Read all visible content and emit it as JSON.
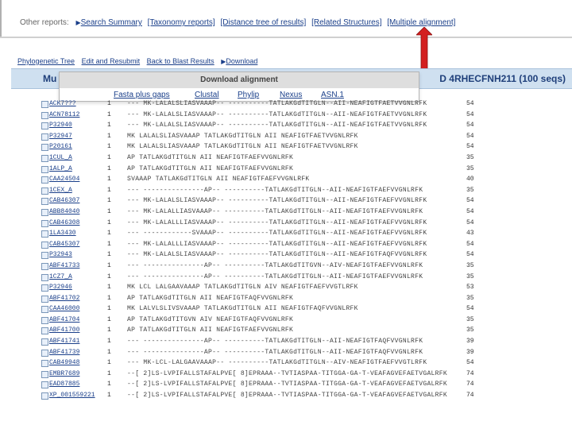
{
  "other_reports": {
    "label": "Other reports:",
    "links": [
      "Search Summary",
      "[Taxonomy reports]",
      "[Distance tree of results]",
      "[Related Structures]",
      "[Multiple alignment]"
    ]
  },
  "nav_links": [
    "Phylogenetic Tree",
    "Edit and Resubmit",
    "Back to Blast Results",
    "Download"
  ],
  "title": {
    "left": "Mu",
    "right": "D 4RHECFNH211 (100 seqs)"
  },
  "download_popup": {
    "title": "Download alignment",
    "options": [
      "Fasta plus gaps",
      "Clustal",
      "Phylip",
      "Nexus",
      "ASN.1"
    ]
  },
  "alignment": [
    {
      "acc": "ACK7???",
      "start": "1",
      "seq": "  ---  MK-LALALSLIASVAAAP--  ----------TATLAKGdTITGLN--AII-NEAFIGTFAETVVGNLRFK",
      "end": "54"
    },
    {
      "acc": "ACN78112",
      "start": "1",
      "seq": "  ---  MK-LALALSLIASVAAAP--  ----------TATLAKGdTITGLN--AII-NEAFIGTFAETVVGNLRFK",
      "end": "54"
    },
    {
      "acc": "P32940",
      "start": "1",
      "seq": "  ---  MK-LALALSLIASVAAAP--  ----------TATLAKGdTITGLN--AII-NEAFIGTFAETVVGNLRFK",
      "end": "54"
    },
    {
      "acc": "P32947",
      "start": "1",
      "seq": "       MK LALALSLIASVAAAP    TATLAKGdTITGLN  AII NEAFIGTFAETVVGNLRFK",
      "end": "54"
    },
    {
      "acc": "P20161",
      "start": "1",
      "seq": "       MK LALALSLIASVAAAP    TATLAKGdTITGLN  AII NEAFIGTFAETVVGNLRFK",
      "end": "54"
    },
    {
      "acc": "1CUL_A",
      "start": "1",
      "seq": "                    AP    TATLAKGdTITGLN  AII NEAFIGTFAEFVVGNLRFK",
      "end": "35"
    },
    {
      "acc": "1ALP_A",
      "start": "1",
      "seq": "                    AP    TATLAKGdTITGLN  AII NEAFIGTFAEFVVGNLRFK",
      "end": "35"
    },
    {
      "acc": "CAA24504",
      "start": "1",
      "seq": "                 SVAAAP    TATLAKGdTITGLN  AII NEAFIGTFAEFVVGNLRFK",
      "end": "40"
    },
    {
      "acc": "1CEX_A",
      "start": "1",
      "seq": "  ---  ---------------AP--  ----------TATLAKGdTITGLN--AII-NEAFIGTFAEFVVGNLRFK",
      "end": "35"
    },
    {
      "acc": "CAB46307",
      "start": "1",
      "seq": "  ---  MK-LALALSLIASVAAAP--  ----------TATLAKGdTITGLN--AII-NEAFIGTFAEFVVGNLRFK",
      "end": "54"
    },
    {
      "acc": "ABB84040",
      "start": "1",
      "seq": "  ---  MK-LALALLIASVAAAP--  ----------TATLAKGdTITGLN--AII-NEAFIGTFAEFVVGNLRFK",
      "end": "54"
    },
    {
      "acc": "CAB46308",
      "start": "1",
      "seq": "  ---  MK-LALALLLIASVAAAP--  ----------TATLAKGdTITGLN--AII-NEAFIGTFAEFVVGNLRFK",
      "end": "54"
    },
    {
      "acc": "1LA3430",
      "start": "1",
      "seq": "  ---  ------------SVAAAP--  ----------TATLAKGdTITGLN--AII-NEAFIGTFAEFVVGNLRFK",
      "end": "43"
    },
    {
      "acc": "CAB45307",
      "start": "1",
      "seq": "  ---  MK-LALALLLIASVAAAP--  ----------TATLAKGdTITGLN--AII-NEAFIGTFAEFVVGNLRFK",
      "end": "54"
    },
    {
      "acc": "P32943",
      "start": "1",
      "seq": "  ---  MK-LALALSLIASVAAAP--  ----------TATLAKGdTITGLN--AII-NEAFIGTFAQFVVGNLRFK",
      "end": "54"
    },
    {
      "acc": "ABF41733",
      "start": "1",
      "seq": "  ---  ---------------AP--  ----------TATLAKGdTITGVN--AIV-NEAFIGTFAEFVVGNLRFK",
      "end": "35"
    },
    {
      "acc": "1CZ7_A",
      "start": "1",
      "seq": "  ---  ---------------AP--  ----------TATLAKGdTITGLN--AII-NEAFIGTFAEFVVGNLRFK",
      "end": "35"
    },
    {
      "acc": "P32946",
      "start": "1",
      "seq": "       MK LCL LALGAAVAAAP    TATLAKGdTITGLN  AIV NEAFIGTFAEFVVGTLRFK",
      "end": "53"
    },
    {
      "acc": "ABF41702",
      "start": "1",
      "seq": "                    AP    TATLAKGdTITGLN  AII NEAFIGTFAQFVVGNLRFK",
      "end": "35"
    },
    {
      "acc": "CAA46000",
      "start": "1",
      "seq": "       MK LALVLSLIVSVAAAP    TATLAKGdTITGLN  AII NEAFIGTFAQFVVGNLRFK",
      "end": "54"
    },
    {
      "acc": "ABF41704",
      "start": "1",
      "seq": "                    AP    TATLAKGdTITGVN  AIV NEAFIGTFAQFVVGNLRFK",
      "end": "35"
    },
    {
      "acc": "ABF41700",
      "start": "1",
      "seq": "                    AP    TATLAKGdTITGLN  AII NEAFIGTFAEFVVGNLRFK",
      "end": "35"
    },
    {
      "acc": "ABF41741",
      "start": "1",
      "seq": "  ---  ---------------AP--  ----------TATLAKGdTITGLN--AII-NEAFIGTFAQFVVGNLRFK",
      "end": "39"
    },
    {
      "acc": "ABF41739",
      "start": "1",
      "seq": "  ---  ---------------AP--  ----------TATLAKGdTITGLN--AII-NEAFIGTFAQFVVGNLRFK",
      "end": "39"
    },
    {
      "acc": "CAB49948",
      "start": "1",
      "seq": "  ---  MK-LCL-LALGAAVAAAP--  ----------TATLAKGdTITGLN--AIV-NEAFIGTFAEFVVGTLRFK",
      "end": "54"
    },
    {
      "acc": "EMBR7689",
      "start": "1",
      "seq": "  --[ 2]LS-LVPIFALLSTAFALPVE[ 8]EPRAAA--TVTIASPAA-TITGGA-GA-T-VEAFAGVEFAETVGALRFK",
      "end": "74"
    },
    {
      "acc": "EAD87885",
      "start": "1",
      "seq": "  --[ 2]LS-LVPIFALLSTAFALPVE[ 8]EPRAAA--TVTIASPAA-TITGGA-GA-T-VEAFAGVEFAETVGALRFK",
      "end": "74"
    },
    {
      "acc": "XP_001559221",
      "start": "1",
      "seq": "  --[ 2]LS-LVPIFALLSTAFALPVE[ 8]EPRAAA--TVTIASPAA-TITGGA-GA-T-VEAFAGVEFAETVGALRFK",
      "end": "74"
    }
  ]
}
